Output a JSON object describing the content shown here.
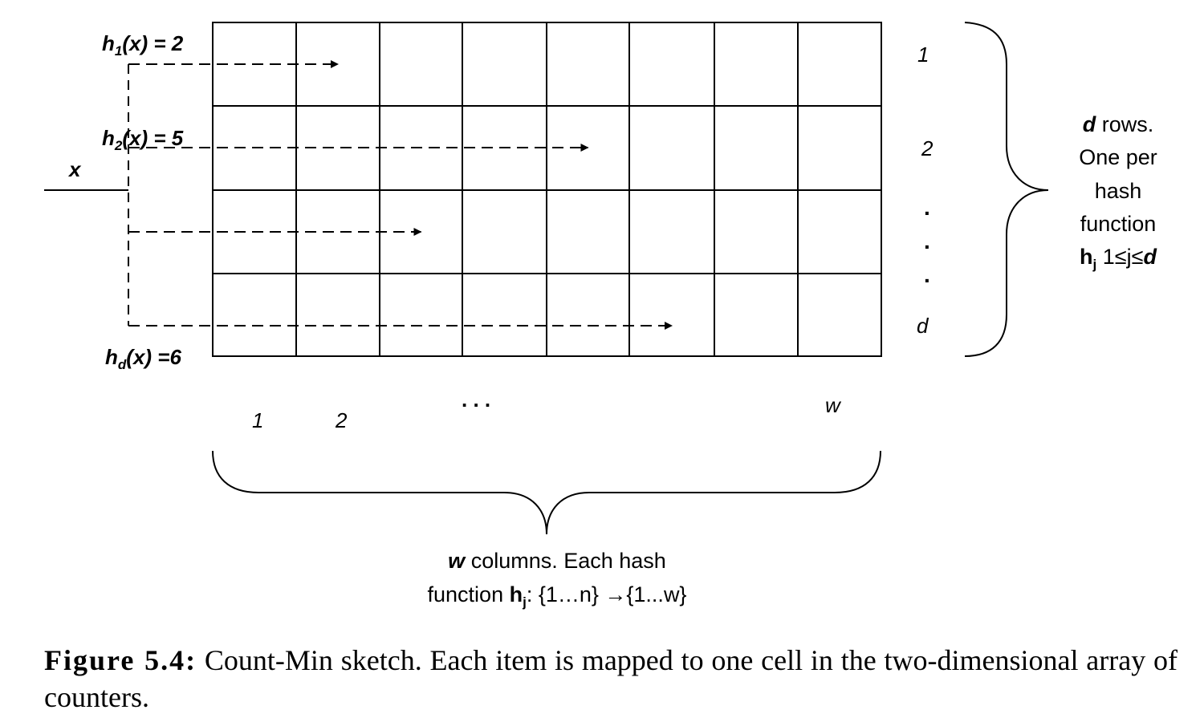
{
  "diagram": {
    "input_label": "x",
    "hash_labels": [
      {
        "name": "h",
        "sub": "1",
        "rest": "(x) = 2",
        "col": 2
      },
      {
        "name": "h",
        "sub": "2",
        "rest": "(x) = 5",
        "col": 5
      },
      {
        "name": "",
        "sub": "",
        "rest": "",
        "col": 3
      },
      {
        "name": "h",
        "sub": "d",
        "rest": "(x) =6",
        "col": 6
      }
    ],
    "row_labels": [
      "1",
      "2",
      "d"
    ],
    "row_ellipsis": ".",
    "column_labels": [
      "1",
      "2",
      "w"
    ],
    "column_ellipsis": ". . .",
    "grid": {
      "rows": 4,
      "cols": 8
    },
    "right_brace_text": {
      "line1_bold": "d",
      "line1_rest": " rows.",
      "line2": "One per",
      "line3": "hash",
      "line4": "function",
      "line5_bold": "h",
      "line5_sub": "j",
      "line5_rest": " 1≤j≤",
      "line5_end": "d"
    },
    "bottom_brace_text": {
      "line1_bold": "w",
      "line1_rest": " columns. Each hash",
      "line2_start": "function ",
      "line2_bold": "h",
      "line2_sub": "j",
      "line2_rest": ": {1…n} →{1...w}"
    }
  },
  "caption": {
    "figure_label": "Figure 5.4:",
    "text": " Count-Min sketch. Each item is mapped to one cell in the two-dimensional array of counters."
  }
}
